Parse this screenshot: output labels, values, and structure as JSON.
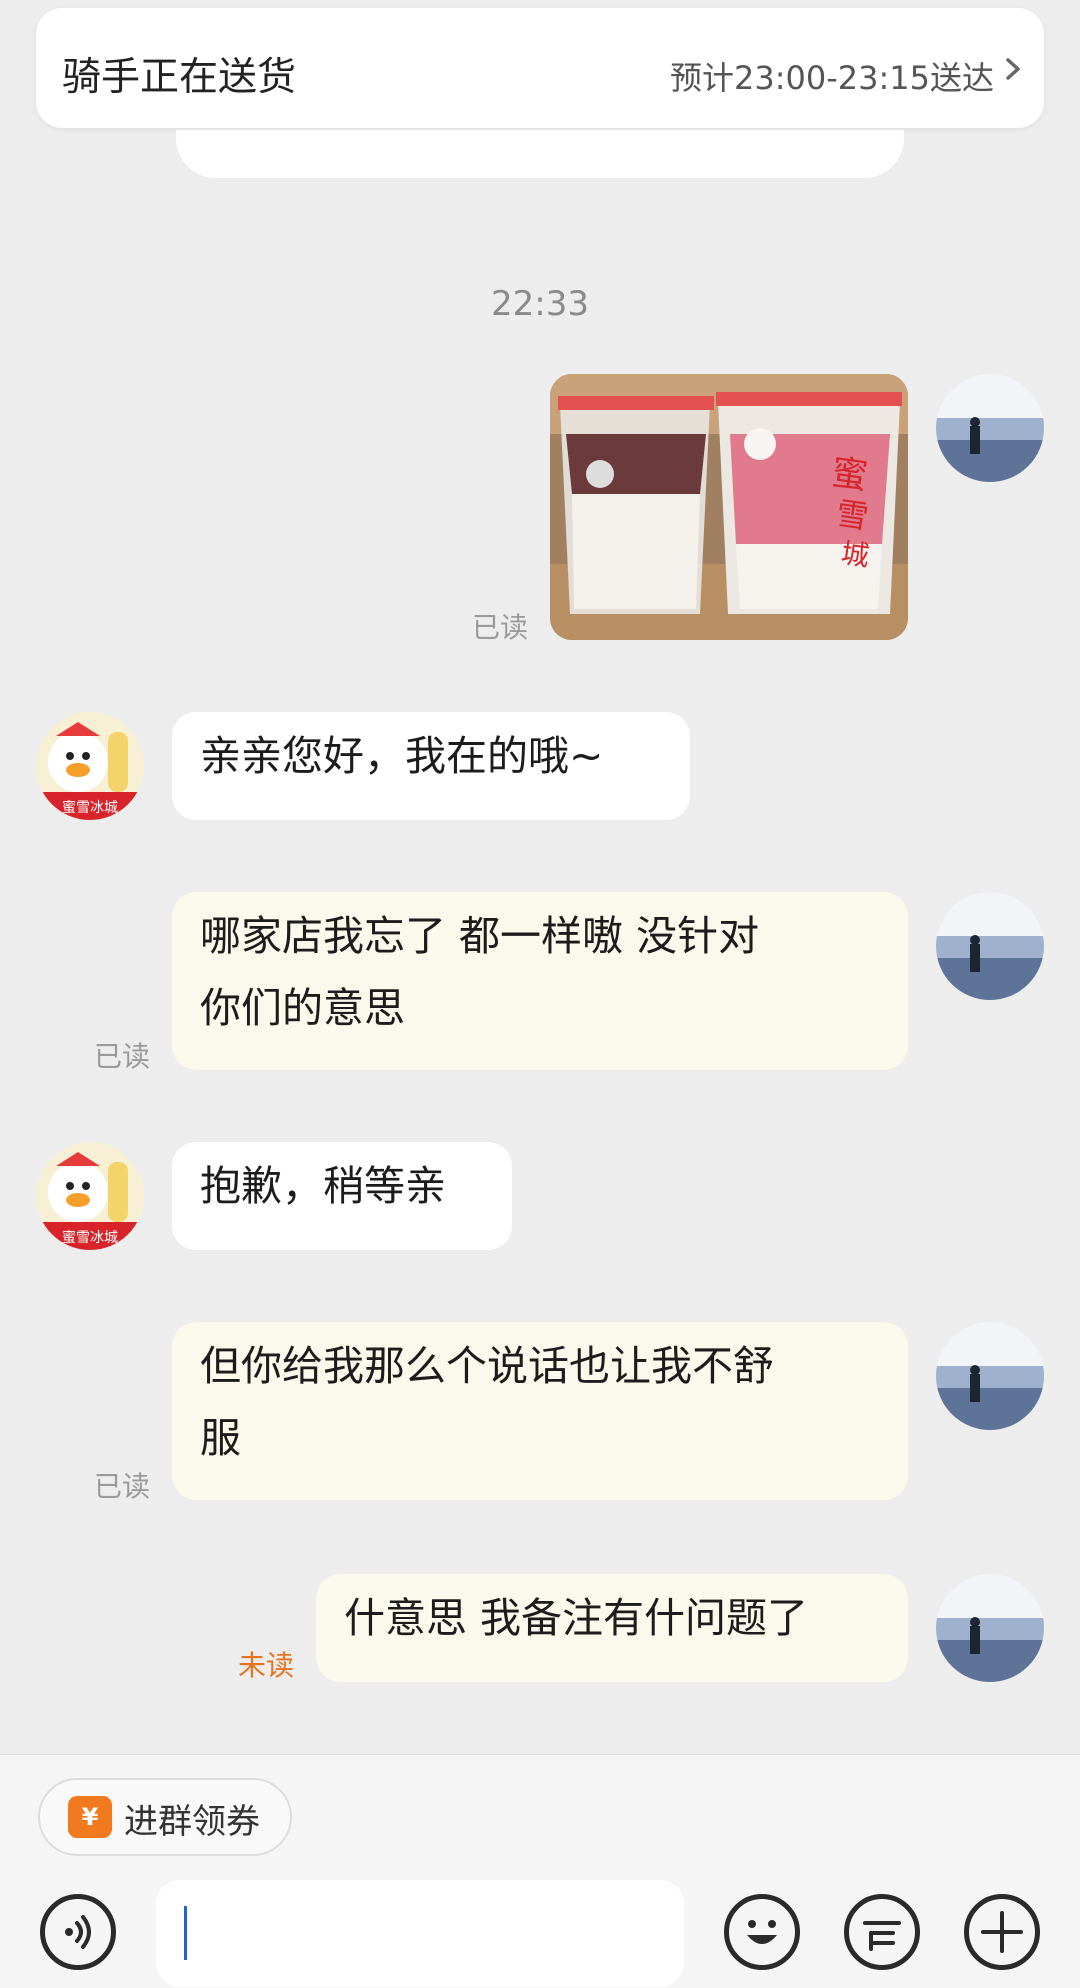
{
  "status": {
    "title": "骑手正在送货",
    "eta": "预计23:00-23:15送达",
    "chevron_icon": "chevron-right-icon"
  },
  "timestamp": "22:33",
  "messages": [
    {
      "type": "image",
      "side": "right",
      "read_status": "已读",
      "image_icon": "ice-cream-cups-photo",
      "image_text": "蜜雪冰城"
    },
    {
      "type": "text",
      "side": "left",
      "text": "亲亲您好，我在的哦~"
    },
    {
      "type": "text",
      "side": "right",
      "lines": [
        "哪家店我忘了 都一样嗷 没针对",
        "你们的意思"
      ],
      "read_status": "已读"
    },
    {
      "type": "text",
      "side": "left",
      "text": "抱歉，稍等亲"
    },
    {
      "type": "text",
      "side": "right",
      "lines": [
        "但你给我那么个说话也让我不舒",
        "服"
      ],
      "read_status": "已读"
    },
    {
      "type": "text",
      "side": "right",
      "text": "什意思 我备注有什问题了",
      "read_status": "未读"
    }
  ],
  "merchant_avatar": {
    "icon": "snow-king-mascot-avatar",
    "text": "蜜雪冰城"
  },
  "user_avatar": {
    "icon": "beach-silhouette-avatar"
  },
  "coupon": {
    "icon_glyph": "¥",
    "label": "进群领券"
  },
  "input": {
    "value": ""
  },
  "toolbar": {
    "voice": "voice-icon",
    "emoji": "emoji-icon",
    "quick": "quick-reply-icon",
    "add": "plus-icon"
  },
  "colors": {
    "background": "#ededed",
    "bubble_out": "#fbf8ec",
    "bubble_in": "#ffffff",
    "unread": "#e8731c",
    "brand_red": "#d8232a"
  }
}
